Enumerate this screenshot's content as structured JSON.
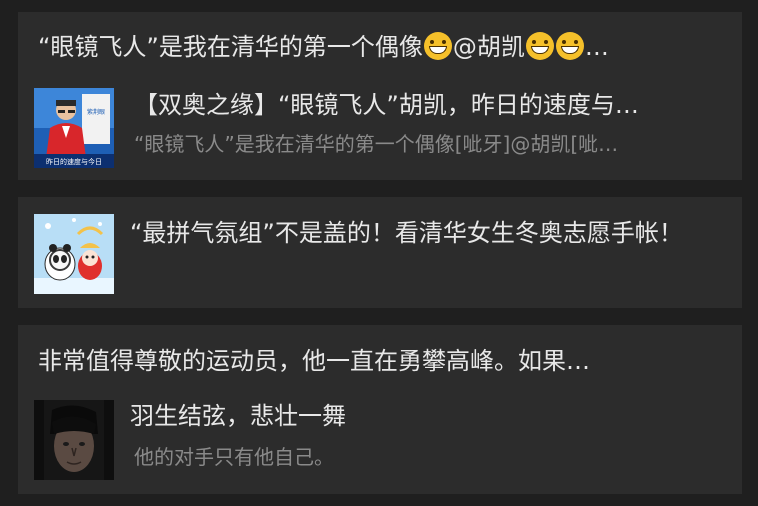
{
  "posts": [
    {
      "comment_part1": "“眼镜飞人”是我在清华的第一个偶像",
      "comment_part2": "@胡凯",
      "comment_ellipsis": "…",
      "emoji": "grinning-face-emoji",
      "title": "【双奥之缘】“眼镜飞人”胡凯，昨日的速度与…",
      "subtitle": "“眼镜飞人”是我在清华的第一个偶像[呲牙]@胡凯[呲…",
      "thumbnail_caption_top": "紫荆眼",
      "thumbnail_caption_bottom": "昨日的速度与今日"
    },
    {
      "title": "“最拼气氛组”不是盖的！看清华女生冬奥志愿手帐！"
    },
    {
      "comment": "非常值得尊敬的运动员，他一直在勇攀高峰。如果…",
      "title": "羽生结弦，悲壮一舞",
      "subtitle": "他的对手只有他自己。"
    }
  ],
  "colors": {
    "background": "#1f1f1f",
    "card": "#2c2c2c",
    "primary_text": "#e8e8e8",
    "secondary_text": "#8a8a8a",
    "emoji": "#f5c02a"
  }
}
